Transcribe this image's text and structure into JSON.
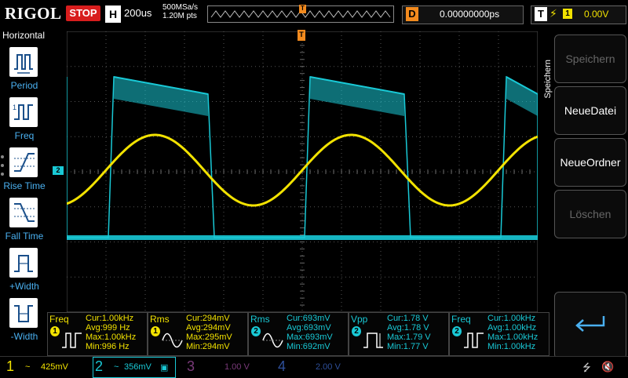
{
  "header": {
    "brand": "RIGOL",
    "state": "STOP",
    "timebase_letter": "H",
    "timebase": "200us",
    "sample_rate": "500MSa/s",
    "points": "1.20M pts",
    "delay_letter": "D",
    "delay": "0.00000000ps",
    "trigger_letter": "T",
    "trigger_channel": "1",
    "trigger_level": "0.00V"
  },
  "left_menu": {
    "title": "Horizontal",
    "items": [
      {
        "label": "Period",
        "icon": "period-icon"
      },
      {
        "label": "Freq",
        "icon": "freq-icon"
      },
      {
        "label": "Rise Time",
        "icon": "rise-time-icon"
      },
      {
        "label": "Fall Time",
        "icon": "fall-time-icon"
      },
      {
        "label": "+Width",
        "icon": "pos-width-icon"
      },
      {
        "label": "-Width",
        "icon": "neg-width-icon"
      }
    ]
  },
  "right_menu": {
    "title": "Speichern",
    "buttons": [
      {
        "label": "Speichern",
        "enabled": false
      },
      {
        "label": "NeueDatei",
        "enabled": true
      },
      {
        "label": "NeueOrdner",
        "enabled": true
      },
      {
        "label": "Löschen",
        "enabled": false
      }
    ],
    "return_icon": "return-icon"
  },
  "markers": {
    "ch2": "2",
    "trigger": "T"
  },
  "measurements": [
    {
      "type": "Freq",
      "channel": "1",
      "channel_color": "#f2e200",
      "cur": "Cur:1.00kHz",
      "avg": "Avg:999 Hz",
      "max": "Max:1.00kHz",
      "min": "Min:996 Hz"
    },
    {
      "type": "Rms",
      "channel": "1",
      "channel_color": "#f2e200",
      "cur": "Cur:294mV",
      "avg": "Avg:294mV",
      "max": "Max:295mV",
      "min": "Min:294mV"
    },
    {
      "type": "Rms",
      "channel": "2",
      "channel_color": "#19c9d6",
      "cur": "Cur:693mV",
      "avg": "Avg:693mV",
      "max": "Max:693mV",
      "min": "Min:692mV"
    },
    {
      "type": "Vpp",
      "channel": "2",
      "channel_color": "#19c9d6",
      "cur": "Cur:1.78 V",
      "avg": "Avg:1.78 V",
      "max": "Max:1.79 V",
      "min": "Min:1.77 V"
    },
    {
      "type": "Freq",
      "channel": "2",
      "channel_color": "#19c9d6",
      "cur": "Cur:1.00kHz",
      "avg": "Avg:1.00kHz",
      "max": "Max:1.00kHz",
      "min": "Min:1.00kHz"
    }
  ],
  "bottom": {
    "ch1_num": "1",
    "ch1_coupling": "~",
    "ch1_scale": "425mV",
    "ch2_num": "2",
    "ch2_coupling": "~",
    "ch2_scale": "356mV",
    "ch3_num": "3",
    "ch3_scale": "1.00 V",
    "ch4_num": "4",
    "ch4_scale": "2.00 V"
  },
  "colors": {
    "ch1": "#f2e200",
    "ch2": "#19c9d6",
    "ch3": "#b04ab0",
    "ch4": "#3b6bd6",
    "trigger": "#f28a1e",
    "stop": "#d81d1d"
  }
}
